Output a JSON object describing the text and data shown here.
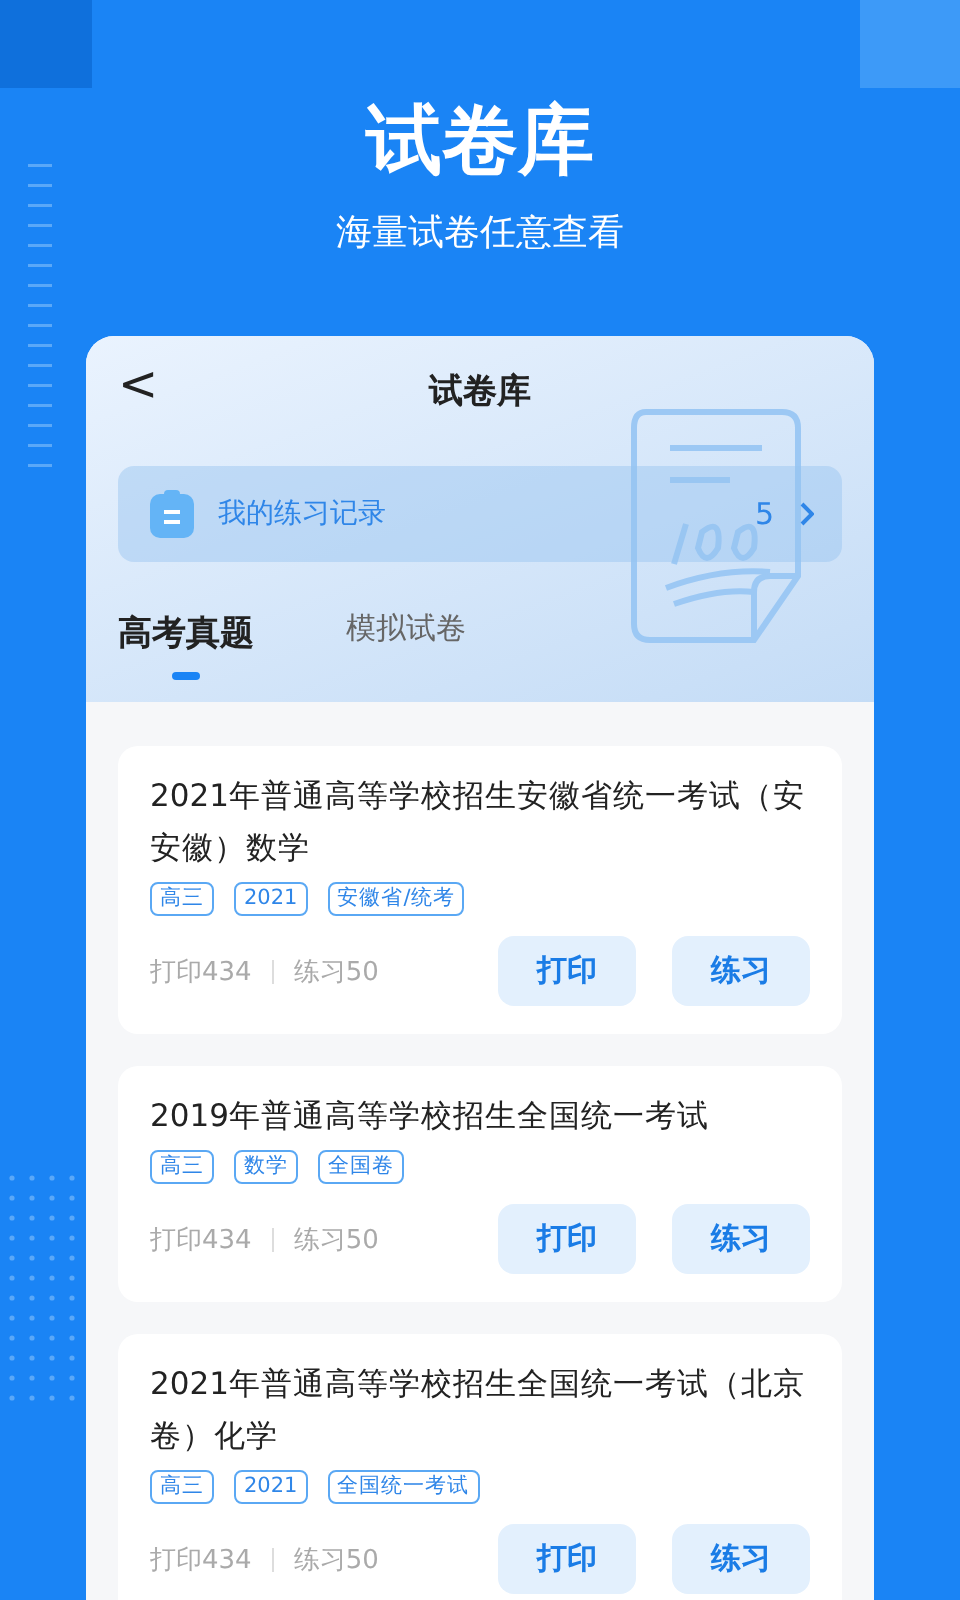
{
  "banner": {
    "title": "试卷库",
    "subtitle": "海量试卷任意查看"
  },
  "header": {
    "back": "<",
    "title": "试卷库"
  },
  "record": {
    "label": "我的练习记录",
    "count": "5"
  },
  "tabs": [
    {
      "label": "高考真题",
      "selected": true
    },
    {
      "label": "模拟试卷",
      "selected": false
    }
  ],
  "papers": [
    {
      "title": "2021年普通高等学校招生安徽省统一考试（安安徽）数学",
      "tags": [
        "高三",
        "2021",
        "安徽省/统考"
      ],
      "prints": "打印434",
      "practices": "练习50",
      "buttons": [
        "打印",
        "练习"
      ]
    },
    {
      "title": "2019年普通高等学校招生全国统一考试",
      "tags": [
        "高三",
        "数学",
        "全国卷"
      ],
      "prints": "打印434",
      "practices": "练习50",
      "buttons": [
        "打印",
        "练习"
      ]
    },
    {
      "title": "2021年普通高等学校招生全国统一考试（北京卷）化学",
      "tags": [
        "高三",
        "2021",
        "全国统一考试"
      ],
      "prints": "打印434",
      "practices": "练习50",
      "buttons": [
        "打印",
        "练习"
      ]
    }
  ]
}
